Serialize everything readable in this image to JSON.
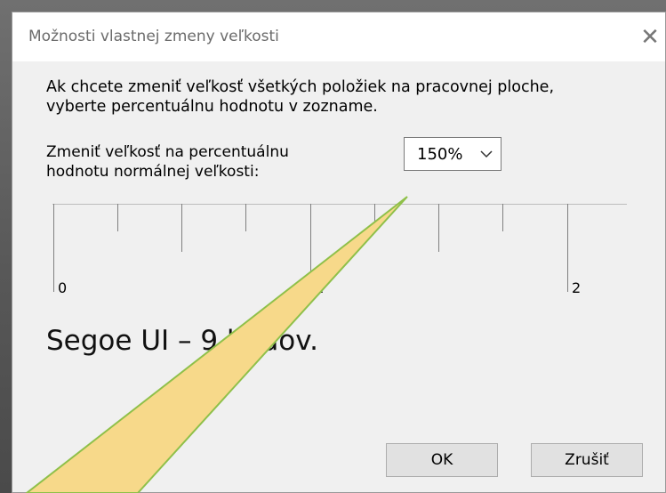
{
  "dialog": {
    "title": "Možnosti vlastnej zmeny veľkosti",
    "close_glyph": "✕",
    "instruction_lines": [
      "Ak chcete zmeniť veľkosť všetkých položiek na pracovnej ploche,",
      "vyberte percentuálnu hodnotu v zozname."
    ],
    "scale_label_lines": [
      "Zmeniť veľkosť na percentuálnu",
      "hodnotu normálnej veľkosti:"
    ],
    "scale_select": {
      "value": "150%"
    },
    "ruler": {
      "labels": [
        "0",
        "1",
        "2"
      ]
    },
    "sample_text": "Segoe UI – 9 bodov.",
    "buttons": {
      "ok_label": "OK",
      "cancel_label": "Zrušiť"
    }
  },
  "callout": {
    "fill_color": "#f7d98a",
    "stroke_color": "#8fc04a"
  }
}
